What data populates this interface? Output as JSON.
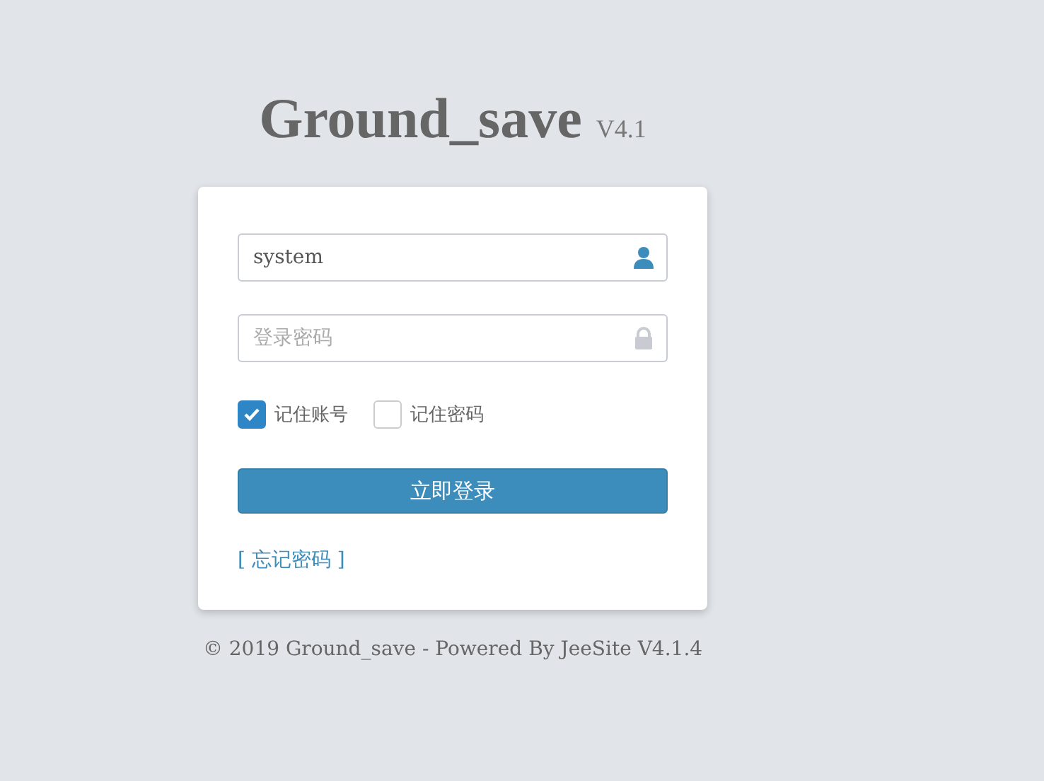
{
  "header": {
    "title": "Ground_save",
    "version": "V4.1"
  },
  "form": {
    "fields": [
      {
        "kind": "user",
        "value": "system"
      },
      {
        "kind": "password",
        "placeholder": "登录密码"
      }
    ],
    "options": [
      {
        "label": "记住账号",
        "checked": true
      },
      {
        "label": "记住密码",
        "checked": false
      }
    ],
    "submit": "立即登录",
    "forgot_link": "[ 忘记密码 ]"
  },
  "footer": "© 2019 Ground_save - Powered By JeeSite V4.1.4"
}
